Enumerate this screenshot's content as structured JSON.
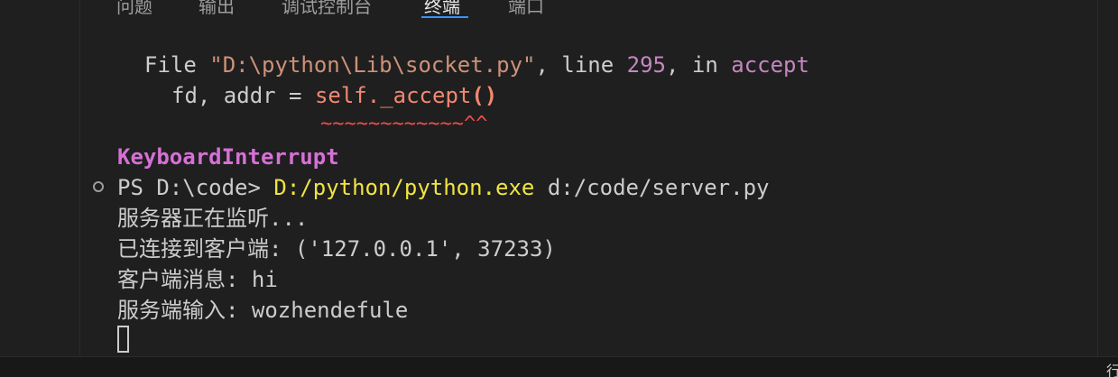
{
  "panel_tabs": {
    "problems": "问题",
    "output": "输出",
    "debug_console": "调试控制台",
    "terminal": "终端",
    "ports": "端口",
    "active_tab": "终端"
  },
  "terminal": {
    "traceback_file_prefix": "File ",
    "traceback_file_path": "\"D:\\python\\Lib\\socket.py\"",
    "traceback_line_label": ", line ",
    "traceback_line_number": "295",
    "traceback_in_label": ", in ",
    "traceback_function": "accept",
    "code_left": "fd, addr = ",
    "code_call": "self._accept",
    "code_parens": "()",
    "error_underline": "~~~~~~~~~~~~^^",
    "keyboard_interrupt": "KeyboardInterrupt",
    "prompt": "PS D:\\code> ",
    "command_exe": "D:/python/python.exe",
    "command_arg": " d:/code/server.py",
    "out_listening": "服务器正在监听...",
    "out_connected": "已连接到客户端: ('127.0.0.1', 37233)",
    "out_client_msg": "客户端消息: hi",
    "out_server_input": "服务端输入: wozhendefule"
  },
  "status": {
    "right_glyph": "行"
  },
  "colors": {
    "background": "#1f1f1f",
    "active_tab_underline": "#3794ff",
    "string": "#ce9178",
    "keyword_purple": "#c586c0",
    "error_red": "#f48771",
    "keyboard_interrupt": "#d670d6",
    "command_yellow": "#f0e442"
  }
}
